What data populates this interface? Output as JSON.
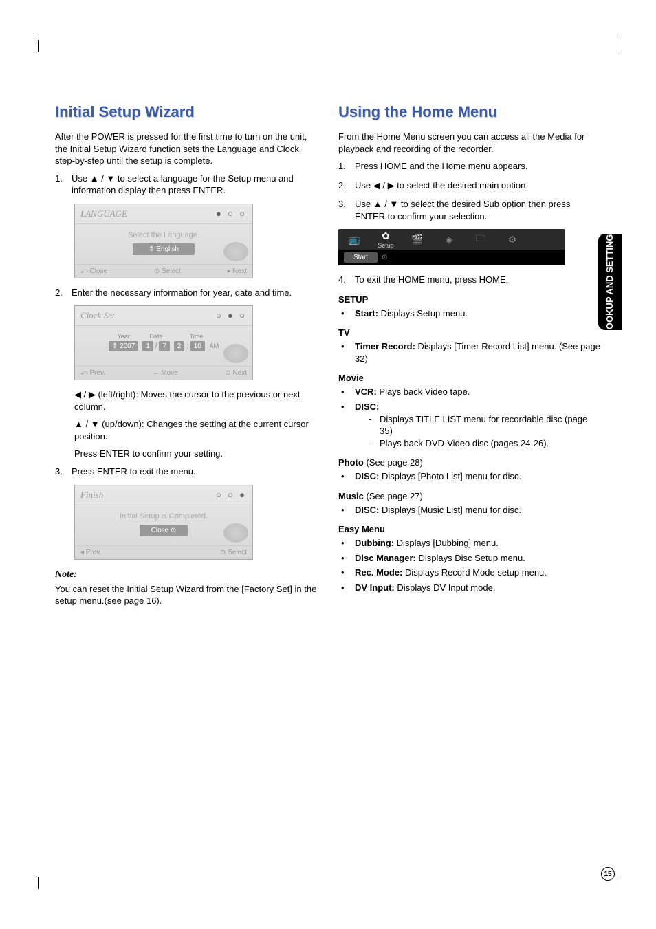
{
  "side_tab": "HOOKUP AND SETTINGS",
  "page_number": "15",
  "left": {
    "title": "Initial Setup Wizard",
    "intro": "After the POWER is pressed for the first time to turn on the unit, the Initial Setup Wizard function sets the Language and Clock step-by-step until the setup is complete.",
    "step1": "Use ▲ / ▼ to select a language for the Setup menu and information display then press ENTER.",
    "scr1": {
      "title": "LANGUAGE",
      "dots": "● ○ ○",
      "hint": "Select the Language.",
      "pill": "⇕ English",
      "foot_l": "⤺ Close",
      "foot_c": "⊙ Select",
      "foot_r": "▸ Next"
    },
    "step2": "Enter the necessary information for year, date and time.",
    "scr2": {
      "title": "Clock Set",
      "dots": "○ ● ○",
      "year_lbl": "Year",
      "date_lbl": "Date",
      "time_lbl": "Time",
      "year": "⇕ 2007",
      "d1": "1",
      "d2": "7",
      "t1": "2",
      "t2": "10",
      "ampm": "AM",
      "foot_l": "⤺ Prev.",
      "foot_c": "↔ Move",
      "foot_r": "⊙ Next"
    },
    "lr_desc": "◀ / ▶ (left/right): Moves the cursor to the previous or next column.",
    "ud_desc": "▲ / ▼ (up/down): Changes the setting at the current cursor position.",
    "enter_desc": "Press ENTER to confirm your setting.",
    "step3": "Press ENTER to exit the menu.",
    "scr3": {
      "title": "Finish",
      "dots": "○ ○ ●",
      "hint": "Initial Setup is Completed.",
      "pill": "Close ⊙",
      "foot_l": "◂ Prev.",
      "foot_r": "⊙ Select"
    },
    "note_head": "Note:",
    "note_body": "You can reset the Initial Setup Wizard from the [Factory Set] in the setup menu.(see page 16)."
  },
  "right": {
    "title": "Using the Home Menu",
    "intro": "From the Home Menu screen you can access all the Media for playback and recording of the recorder.",
    "step1": "Press HOME and the Home menu appears.",
    "step2": "Use ◀ / ▶ to select the desired main option.",
    "step3": "Use ▲ / ▼ to select the desired Sub option then press ENTER to confirm your selection.",
    "home_bar": {
      "setup_lbl": "Setup",
      "start": "Start"
    },
    "step4": "To exit the HOME menu, press HOME.",
    "setup_head": "SETUP",
    "setup_start_b": "Start:",
    "setup_start_t": " Displays Setup menu.",
    "tv_head": "TV",
    "tv_timer_b": "Timer Record:",
    "tv_timer_t": " Displays [Timer Record List] menu. (See page 32)",
    "movie_head": "Movie",
    "movie_vcr_b": "VCR:",
    "movie_vcr_t": " Plays back Video tape.",
    "movie_disc_b": "DISC:",
    "movie_disc_s1": "Displays TITLE LIST menu for recordable disc (page 35)",
    "movie_disc_s2": "Plays back DVD-Video disc (pages 24-26).",
    "photo_head": "Photo",
    "photo_note": " (See page 28)",
    "photo_disc_b": "DISC:",
    "photo_disc_t": " Displays [Photo List] menu for disc.",
    "music_head": "Music",
    "music_note": " (See page 27)",
    "music_disc_b": "DISC:",
    "music_disc_t": " Displays [Music List] menu for disc.",
    "easy_head": "Easy Menu",
    "easy_dub_b": "Dubbing:",
    "easy_dub_t": " Displays [Dubbing] menu.",
    "easy_dm_b": "Disc Manager:",
    "easy_dm_t": " Displays Disc Setup menu.",
    "easy_rec_b": "Rec. Mode:",
    "easy_rec_t": " Displays Record Mode setup menu.",
    "easy_dv_b": "DV Input:",
    "easy_dv_t": " Displays DV Input mode."
  }
}
